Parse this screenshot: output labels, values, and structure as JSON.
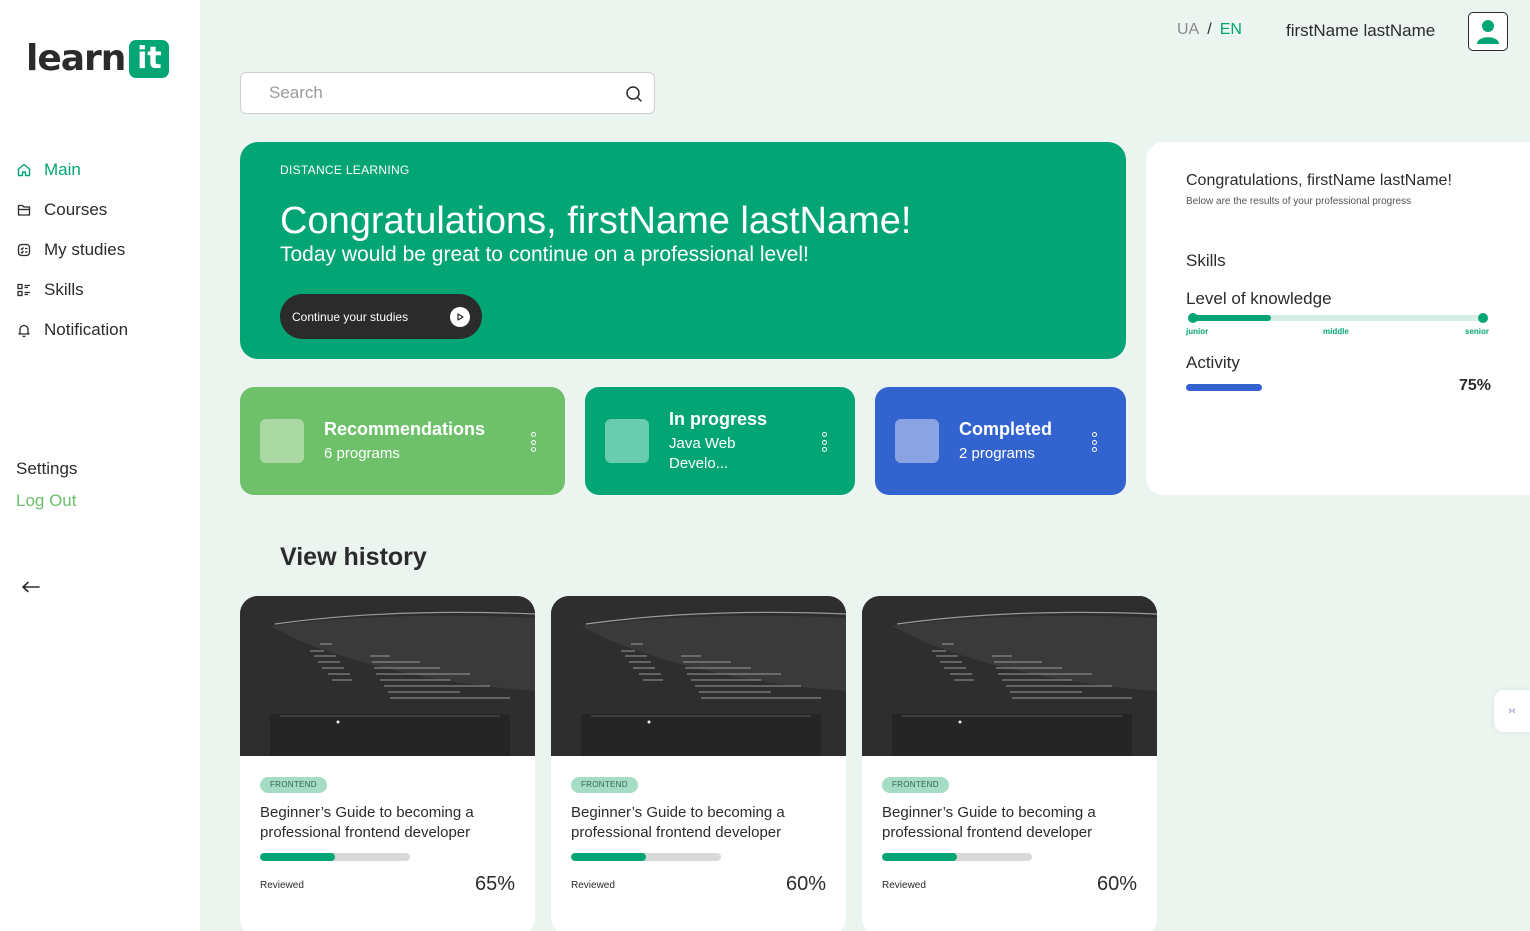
{
  "brand": {
    "logo_text": "learn",
    "logo_badge": "it"
  },
  "sidebar": {
    "items": [
      {
        "label": "Main",
        "icon": "home-icon",
        "active": true
      },
      {
        "label": "Courses",
        "icon": "folder-icon",
        "active": false
      },
      {
        "label": "My studies",
        "icon": "studies-icon",
        "active": false
      },
      {
        "label": "Skills",
        "icon": "list-icon",
        "active": false
      },
      {
        "label": "Notification",
        "icon": "bell-icon",
        "active": false
      }
    ],
    "settings": "Settings",
    "logout": "Log Out",
    "collapse_icon": "arrow-left-icon"
  },
  "header": {
    "lang_ua": "UA",
    "lang_sep": "/",
    "lang_en": "EN",
    "username": "firstName lastName",
    "avatar_icon": "user-icon"
  },
  "search": {
    "placeholder": "Search",
    "icon": "search-icon"
  },
  "hero": {
    "kicker": "DISTANCE LEARNING",
    "title": "Congratulations, firstName lastName!",
    "subtitle": "Today would be great to continue on a professional level!",
    "button": "Continue your studies",
    "button_icon": "play-icon"
  },
  "cards": [
    {
      "title": "Recommendations",
      "subtitle": "6 programs",
      "color": "#6ec06a"
    },
    {
      "title": "In progress",
      "subtitle": "Java Web Develo...",
      "color": "#04a574"
    },
    {
      "title": "Completed",
      "subtitle": "2 programs",
      "color": "#3363cf"
    }
  ],
  "progress": {
    "title": "Congratulations, firstName lastName!",
    "subtitle": "Below are the results of your professional progress",
    "skills": "Skills",
    "level_label": "Level of knowledge",
    "level_fraction": 0.27,
    "level_marks": [
      "junior",
      "middle",
      "senior"
    ],
    "activity_label": "Activity",
    "activity_percent": "75%"
  },
  "history": {
    "title": "View history",
    "items": [
      {
        "tag": "FRONTEND",
        "title": "Beginner’s Guide to becoming a professional frontend developer",
        "status": "Reviewed",
        "percent": "65%",
        "progress": 0.5
      },
      {
        "tag": "FRONTEND",
        "title": "Beginner’s Guide to becoming a professional frontend developer",
        "status": "Reviewed",
        "percent": "60%",
        "progress": 0.5
      },
      {
        "tag": "FRONTEND",
        "title": "Beginner’s Guide to becoming a professional frontend developer",
        "status": "Reviewed",
        "percent": "60%",
        "progress": 0.5
      }
    ]
  },
  "colors": {
    "accent": "#04a574",
    "green_light": "#6ec06a",
    "blue": "#3363cf",
    "background": "#ecf4f0"
  }
}
